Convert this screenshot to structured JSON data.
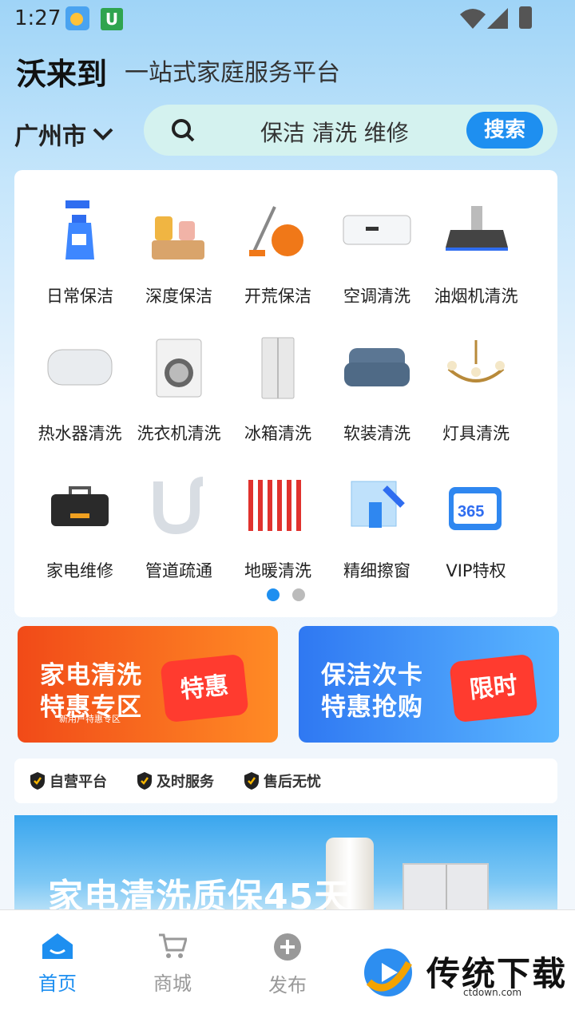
{
  "status": {
    "time": "1:27",
    "u": "U"
  },
  "header": {
    "brand": "沃来到",
    "slogan": "一站式家庭服务平台"
  },
  "location": {
    "city": "广州市"
  },
  "search": {
    "placeholder": "保洁 清洗 维修",
    "button": "搜索"
  },
  "services": [
    {
      "label": "日常保洁",
      "icon": "spray-bottle"
    },
    {
      "label": "深度保洁",
      "icon": "cleaning-supplies"
    },
    {
      "label": "开荒保洁",
      "icon": "vacuum-cleaner"
    },
    {
      "label": "空调清洗",
      "icon": "air-conditioner"
    },
    {
      "label": "油烟机清洗",
      "icon": "range-hood"
    },
    {
      "label": "热水器清洗",
      "icon": "water-heater"
    },
    {
      "label": "洗衣机清洗",
      "icon": "washing-machine"
    },
    {
      "label": "冰箱清洗",
      "icon": "refrigerator"
    },
    {
      "label": "软装清洗",
      "icon": "sofa"
    },
    {
      "label": "灯具清洗",
      "icon": "chandelier"
    },
    {
      "label": "家电维修",
      "icon": "toolbox"
    },
    {
      "label": "管道疏通",
      "icon": "pipe"
    },
    {
      "label": "地暖清洗",
      "icon": "floor-heating"
    },
    {
      "label": "精细擦窗",
      "icon": "window-cleaning"
    },
    {
      "label": "VIP特权",
      "icon": "vip-calendar"
    }
  ],
  "pager": {
    "pages": 2,
    "current": 1
  },
  "banners": {
    "left": {
      "line1": "家电清洗",
      "line2": "特惠专区",
      "sub": "新用户特惠专区",
      "badge": "特惠"
    },
    "right": {
      "line1": "保洁次卡",
      "line2": "特惠抢购",
      "badge": "限时"
    }
  },
  "trust": [
    "自营平台",
    "及时服务",
    "售后无忧"
  ],
  "promo": {
    "text": "家电清洗质保45天"
  },
  "tabs": [
    {
      "label": "首页",
      "icon": "home-icon",
      "active": true
    },
    {
      "label": "商城",
      "icon": "cart-icon",
      "active": false
    },
    {
      "label": "发布",
      "icon": "plus-circle-icon",
      "active": false
    }
  ],
  "watermark": {
    "text": "传统下载",
    "sub": "ctdown.com"
  },
  "colors": {
    "accent": "#1e8ff0",
    "search_bg": "#d4f2ef",
    "promo_orange": "#f14a18",
    "promo_blue": "#2f78f2"
  }
}
